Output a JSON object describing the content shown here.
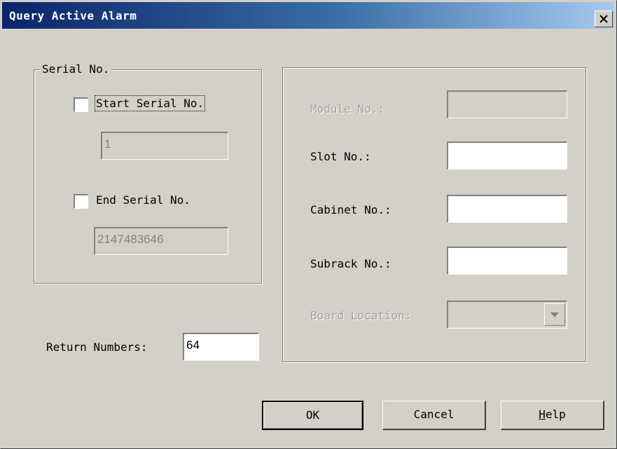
{
  "window": {
    "title": "Query Active Alarm"
  },
  "serial_group": {
    "legend": "Serial No.",
    "start": {
      "label": "Start Serial No.",
      "checked": false,
      "value": "1"
    },
    "end": {
      "label": "End Serial No.",
      "checked": false,
      "value": "2147483646"
    }
  },
  "return_numbers": {
    "label": "Return Numbers:",
    "value": "64"
  },
  "location_group": {
    "module": {
      "label": "Module No.:",
      "value": ""
    },
    "slot": {
      "label": "Slot No.:",
      "value": ""
    },
    "cabinet": {
      "label": "Cabinet No.:",
      "value": ""
    },
    "subrack": {
      "label": "Subrack No.:",
      "value": ""
    },
    "board_location": {
      "label": "Board Location:",
      "value": ""
    }
  },
  "buttons": {
    "ok": "OK",
    "cancel": "Cancel",
    "help": "Help"
  },
  "colors": {
    "title_bar_start": "#0a246a",
    "title_bar_end": "#a6caf0",
    "dialog_face": "#d4d0c8",
    "disabled_text": "#a0a0a0"
  }
}
